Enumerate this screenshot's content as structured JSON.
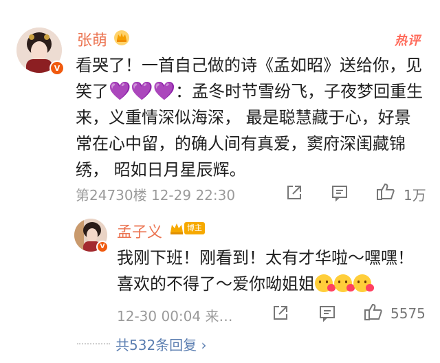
{
  "comment": {
    "author": "张萌",
    "hot_label": "热评",
    "text_before_emoji": "看哭了！一首自己做的诗《孟如昭》送给你，见笑了",
    "emoji_hearts": "💜💜💜",
    "text_after_emoji": "：孟冬时节雪纷飞，子夜梦回重生来，义重情深似海深， 最是聪慧藏于心，好景常在心中留，的确人间有真爱，窦府深闺藏锦绣， 昭如日月星辰辉。",
    "floor_time": "第24730楼  12-29 22:30",
    "like_count": "1万",
    "verified_badge": "V"
  },
  "reply": {
    "author": "孟子义",
    "tag": "博主",
    "text": "我刚下班！刚看到！太有才华啦～嘿嘿！喜欢的不得了～爱你呦姐姐",
    "time": "12-30 00:04  来…",
    "like_count": "5575",
    "verified_badge": "V"
  },
  "more_replies": "共532条回复 ›",
  "colors": {
    "name": "#eb7350",
    "hot": "#ff6a5a",
    "badge": "#f05a0f",
    "link": "#5a7db0"
  }
}
